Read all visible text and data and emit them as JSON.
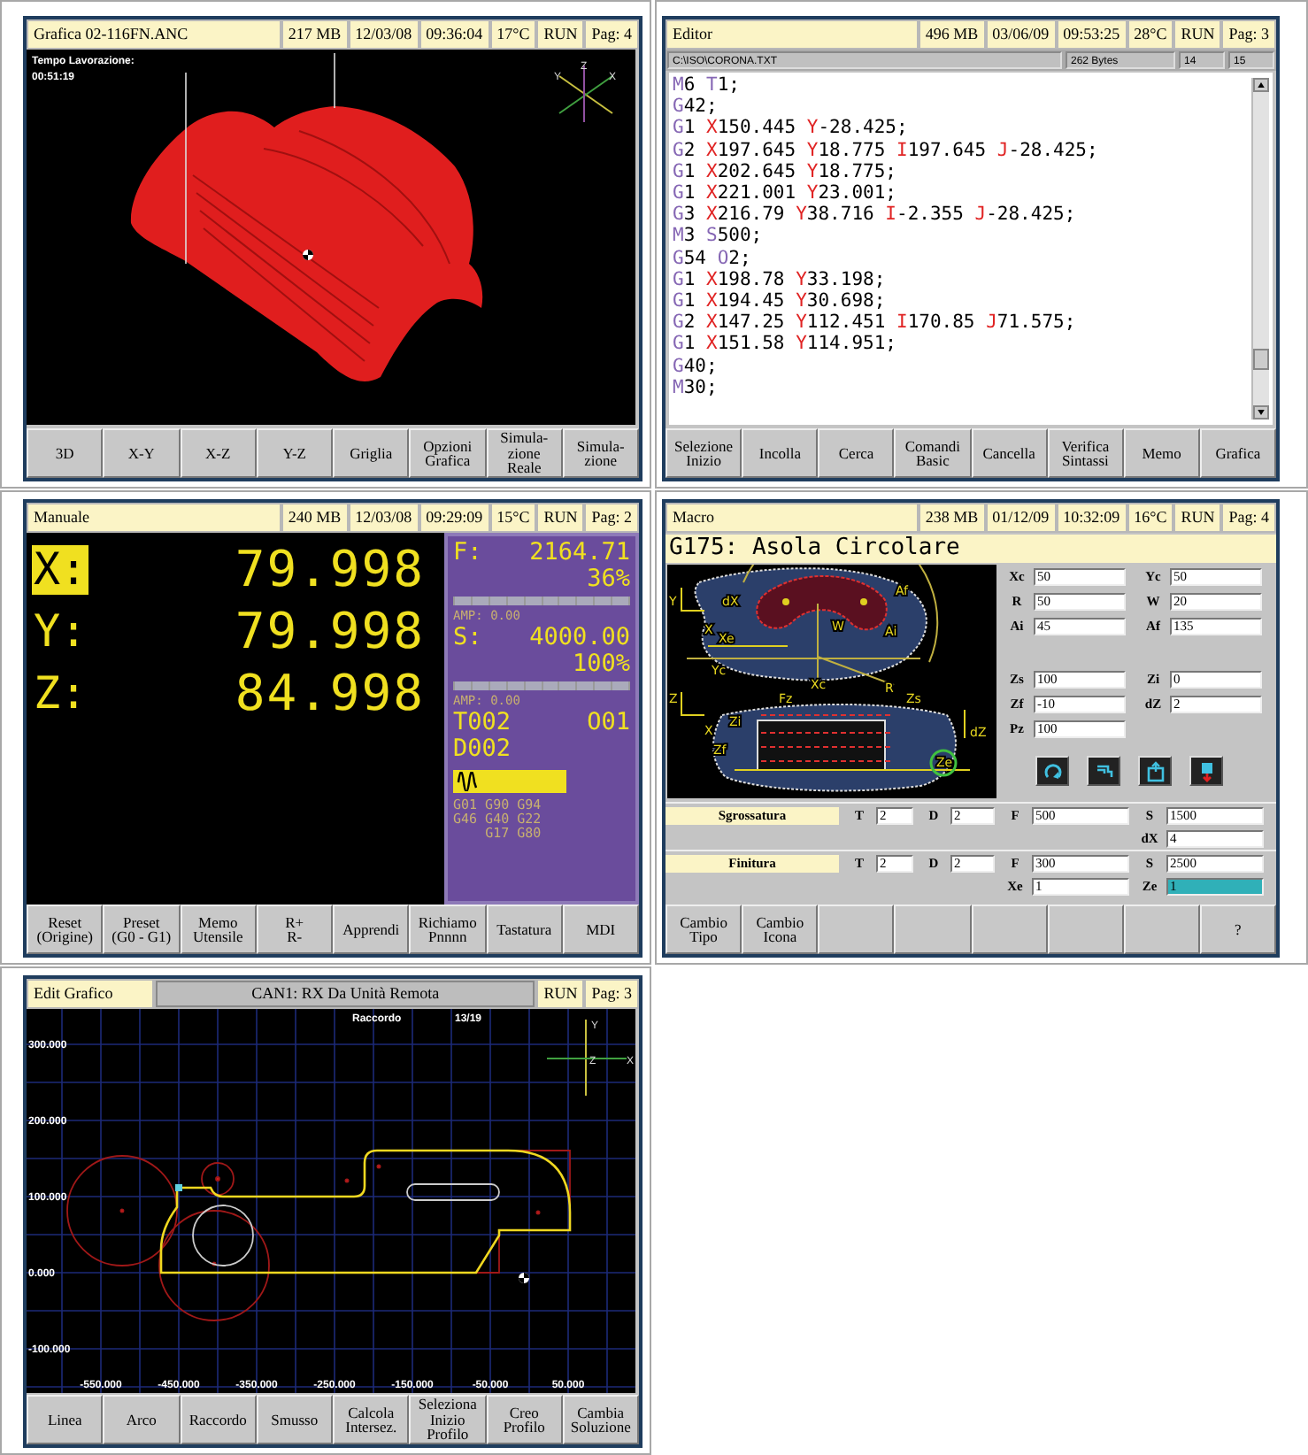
{
  "panels": [
    {
      "kind": "graphics",
      "header": {
        "title": "Grafica 02-116FN.ANC",
        "cells": [
          "217 MB",
          "12/03/08",
          "09:36:04",
          "17°C",
          "RUN",
          "Pag: 4"
        ]
      },
      "time_label": "Tempo Lavorazione:",
      "time_value": "00:51:19",
      "axes": [
        "Y",
        "Z",
        "X"
      ],
      "softkeys": [
        {
          "kind": "key",
          "label": "3D"
        },
        {
          "kind": "key",
          "label": "X-Y"
        },
        {
          "kind": "key",
          "label": "X-Z"
        },
        {
          "kind": "key",
          "label": "Y-Z"
        },
        {
          "kind": "key",
          "label": "Griglia"
        },
        {
          "kind": "key",
          "label": "Opzioni\nGrafica"
        },
        {
          "kind": "key",
          "label": "Simula-\nzione\nReale"
        },
        {
          "kind": "key",
          "label": "Simula-\nzione"
        }
      ]
    },
    {
      "kind": "editor",
      "header": {
        "title": "Editor",
        "cells": [
          "496 MB",
          "03/06/09",
          "09:53:25",
          "28°C",
          "RUN",
          "Pag: 3"
        ]
      },
      "file": {
        "path": "C:\\ISO\\CORONA.TXT",
        "size": "262 Bytes",
        "line": "14",
        "column": "15"
      },
      "lines": [
        [
          {
            "t": "M6",
            "kind": "word"
          },
          {
            "t": "T1;",
            "kind": "word"
          }
        ],
        [
          {
            "t": "G42;",
            "kind": "word"
          }
        ],
        [
          {
            "t": "G1",
            "kind": "word"
          },
          {
            "t": "X150.445",
            "kind": "coord"
          },
          {
            "t": "Y-28.425;",
            "kind": "coord"
          }
        ],
        [
          {
            "t": "G2",
            "kind": "word"
          },
          {
            "t": "X197.645",
            "kind": "coord"
          },
          {
            "t": "Y18.775",
            "kind": "coord"
          },
          {
            "t": "I197.645",
            "kind": "coord"
          },
          {
            "t": "J-28.425;",
            "kind": "coord"
          }
        ],
        [
          {
            "t": "G1",
            "kind": "word"
          },
          {
            "t": "X202.645",
            "kind": "coord"
          },
          {
            "t": "Y18.775;",
            "kind": "coord"
          }
        ],
        [
          {
            "t": "G1",
            "kind": "word"
          },
          {
            "t": "X221.001",
            "kind": "coord"
          },
          {
            "t": "Y23.001;",
            "kind": "coord"
          }
        ],
        [
          {
            "t": "G3",
            "kind": "word"
          },
          {
            "t": "X216.79",
            "kind": "coord"
          },
          {
            "t": "Y38.716",
            "kind": "coord"
          },
          {
            "t": "I-2.355",
            "kind": "coord"
          },
          {
            "t": "J-28.425;",
            "kind": "coord"
          }
        ],
        [
          {
            "t": "M3",
            "kind": "word"
          },
          {
            "t": "S500;",
            "kind": "word"
          }
        ],
        [
          {
            "t": "G54",
            "kind": "word"
          },
          {
            "t": "O2;",
            "kind": "word"
          }
        ],
        [
          {
            "t": "G1",
            "kind": "word"
          },
          {
            "t": "X198.78",
            "kind": "coord"
          },
          {
            "t": "Y33.198;",
            "kind": "coord"
          }
        ],
        [
          {
            "t": "G1",
            "kind": "word"
          },
          {
            "t": "X194.45",
            "kind": "coord"
          },
          {
            "t": "Y30.698;",
            "kind": "coord"
          }
        ],
        [
          {
            "t": "G2",
            "kind": "word"
          },
          {
            "t": "X147.25",
            "kind": "coord"
          },
          {
            "t": "Y112.451",
            "kind": "coord"
          },
          {
            "t": "I170.85",
            "kind": "coord"
          },
          {
            "t": "J71.575;",
            "kind": "coord"
          }
        ],
        [
          {
            "t": "G1",
            "kind": "word"
          },
          {
            "t": "X151.58",
            "kind": "coord"
          },
          {
            "t": "Y114.951;",
            "kind": "coord"
          }
        ],
        [
          {
            "t": "G40;",
            "kind": "word"
          }
        ],
        [
          {
            "t": "M30;",
            "kind": "word"
          }
        ]
      ],
      "softkeys": [
        {
          "kind": "key",
          "label": "Selezione\nInizio"
        },
        {
          "kind": "key",
          "label": "Incolla"
        },
        {
          "kind": "key",
          "label": "Cerca"
        },
        {
          "kind": "key",
          "label": "Comandi\nBasic"
        },
        {
          "kind": "key",
          "label": "Cancella"
        },
        {
          "kind": "key",
          "label": "Verifica\nSintassi"
        },
        {
          "kind": "key",
          "label": "Memo"
        },
        {
          "kind": "key",
          "label": "Grafica"
        }
      ]
    },
    {
      "kind": "manual",
      "header": {
        "title": "Manuale",
        "cells": [
          "240 MB",
          "12/03/08",
          "09:29:09",
          "15°C",
          "RUN",
          "Pag: 2"
        ]
      },
      "axes": [
        {
          "label": "X:",
          "value": "79.998",
          "selected": true
        },
        {
          "label": "Y:",
          "value": "79.998",
          "selected": false
        },
        {
          "label": "Z:",
          "value": "84.998",
          "selected": false
        }
      ],
      "feed": {
        "label": "F:",
        "value": "2164.71",
        "percent": "36%",
        "amp": "AMP: 0.00"
      },
      "spindle": {
        "label": "S:",
        "value": "4000.00",
        "percent": "100%",
        "amp": "AMP: 0.00"
      },
      "tool": "T002",
      "origin": "O01",
      "correction": "D002",
      "gcodes": [
        "G01 G90 G94",
        "G46 G40 G22",
        "G17 G80"
      ],
      "softkeys": [
        {
          "kind": "key",
          "label": "Reset\n(Origine)"
        },
        {
          "kind": "key",
          "label": "Preset\n(G0 - G1)"
        },
        {
          "kind": "key",
          "label": "Memo\nUtensile"
        },
        {
          "kind": "key",
          "label": "R+\nR-"
        },
        {
          "kind": "key",
          "label": "Apprendi"
        },
        {
          "kind": "key",
          "label": "Richiamo\nPnnnn"
        },
        {
          "kind": "key",
          "label": "Tastatura"
        },
        {
          "kind": "key",
          "label": "MDI"
        }
      ]
    },
    {
      "kind": "macro",
      "header": {
        "title": "Macro",
        "cells": [
          "238 MB",
          "01/12/09",
          "10:32:09",
          "16°C",
          "RUN",
          "Pag: 4"
        ]
      },
      "macro_title": "G175: Asola Circolare",
      "diagram_labels": [
        "Y",
        "dX",
        "X",
        "Xe",
        "Yc",
        "Xc",
        "R",
        "Ai",
        "Af",
        "W",
        "Z",
        "X",
        "Zi",
        "Fz",
        "Zs",
        "dZ",
        "Zf",
        "Ze"
      ],
      "params_top": [
        [
          {
            "label": "Xc",
            "value": "50",
            "selected": false
          },
          {
            "label": "Yc",
            "value": "50",
            "selected": false
          }
        ],
        [
          {
            "label": "R",
            "value": "50",
            "selected": false
          },
          {
            "label": "W",
            "value": "20",
            "selected": false
          }
        ],
        [
          {
            "label": "Ai",
            "value": "45",
            "selected": false
          },
          {
            "label": "Af",
            "value": "135",
            "selected": false
          }
        ]
      ],
      "params_bottom": [
        [
          {
            "label": "Zs",
            "value": "100",
            "selected": false
          },
          {
            "label": "Zi",
            "value": "0",
            "selected": false
          }
        ],
        [
          {
            "label": "Zf",
            "value": "-10",
            "selected": false
          },
          {
            "label": "dZ",
            "value": "2",
            "selected": false
          }
        ],
        [
          {
            "label": "Pz",
            "value": "100",
            "selected": false
          }
        ]
      ],
      "cycles": [
        {
          "name": "Sgrossatura",
          "fields": [
            {
              "label": "T",
              "value": "2",
              "selected": false
            },
            {
              "label": "D",
              "value": "2",
              "selected": false
            },
            {
              "label": "F",
              "value": "500",
              "selected": false
            },
            {
              "label": "S",
              "value": "1500",
              "selected": false
            }
          ],
          "extras": [
            {
              "label": "dX",
              "value": "4",
              "selected": false
            }
          ]
        },
        {
          "name": "Finitura",
          "fields": [
            {
              "label": "T",
              "value": "2",
              "selected": false
            },
            {
              "label": "D",
              "value": "2",
              "selected": false
            },
            {
              "label": "F",
              "value": "300",
              "selected": false
            },
            {
              "label": "S",
              "value": "2500",
              "selected": false
            }
          ],
          "extras": [
            {
              "label": "Xe",
              "value": "1",
              "selected": false
            },
            {
              "label": "Ze",
              "value": "1",
              "selected": true
            }
          ]
        }
      ],
      "softkeys": [
        {
          "kind": "key",
          "label": "Cambio\nTipo"
        },
        {
          "kind": "key",
          "label": "Cambio\nIcona"
        },
        {
          "kind": "empty"
        },
        {
          "kind": "empty"
        },
        {
          "kind": "empty"
        },
        {
          "kind": "empty"
        },
        {
          "kind": "empty"
        },
        {
          "kind": "key",
          "label": "?"
        }
      ]
    },
    {
      "kind": "profile",
      "header": {
        "title": "Edit Grafico",
        "message": "CAN1: RX Da Unità Remota",
        "cells": [
          "RUN",
          "Pag: 3"
        ]
      },
      "mode": "Raccordo",
      "counter": "13/19",
      "axes": [
        "Y",
        "Z",
        "X"
      ],
      "y_labels": [
        "300.000",
        "200.000",
        "100.000",
        "0.000",
        "-100.000"
      ],
      "x_labels": [
        "-550.000",
        "-450.000",
        "-350.000",
        "-250.000",
        "-150.000",
        "-50.000",
        "50.000"
      ],
      "softkeys": [
        {
          "kind": "key",
          "label": "Linea"
        },
        {
          "kind": "key",
          "label": "Arco"
        },
        {
          "kind": "key",
          "label": "Raccordo"
        },
        {
          "kind": "key",
          "label": "Smusso"
        },
        {
          "kind": "key",
          "label": "Calcola\nIntersez."
        },
        {
          "kind": "key",
          "label": "Seleziona\nInizio\nProfilo"
        },
        {
          "kind": "key",
          "label": "Creo\nProfilo"
        },
        {
          "kind": "key",
          "label": "Cambia\nSoluzione"
        }
      ]
    }
  ]
}
